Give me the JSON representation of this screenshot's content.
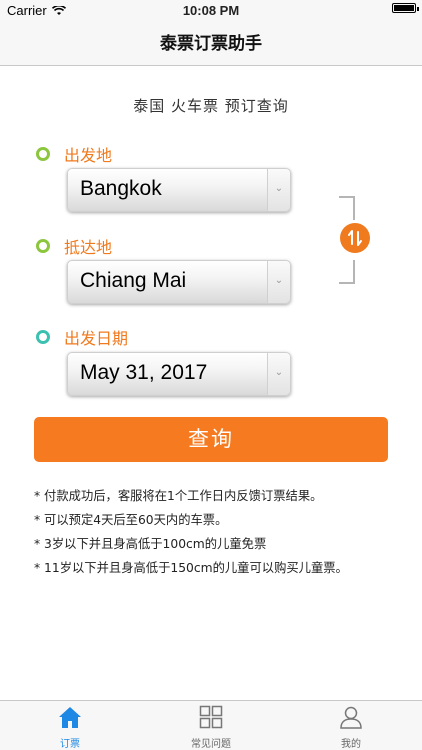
{
  "status_bar": {
    "carrier": "Carrier",
    "time": "10:08 PM",
    "battery_level": 1.0
  },
  "nav": {
    "title": "泰票订票助手"
  },
  "headline": "泰国  火车票  预订查询",
  "from": {
    "label": "出发地",
    "value": "Bangkok"
  },
  "to": {
    "label": "抵达地",
    "value": "Chiang Mai"
  },
  "date": {
    "label": "出发日期",
    "value": "May 31, 2017"
  },
  "query_button": "查询",
  "notes": [
    "* 付款成功后，客服将在1个工作日内反馈订票结果。",
    "* 可以预定4天后至60天内的车票。",
    "* 3岁以下并且身高低于100cm的儿童免票",
    "* 11岁以下并且身高低于150cm的儿童可以购买儿童票。"
  ],
  "tabs": [
    {
      "label": "订票",
      "icon": "home-icon",
      "active": true
    },
    {
      "label": "常见问题",
      "icon": "grid-icon",
      "active": false
    },
    {
      "label": "我的",
      "icon": "person-icon",
      "active": false
    }
  ],
  "colors": {
    "accent": "#f57a20",
    "tab_active": "#1e88e5",
    "dot_green": "#8cc63f",
    "dot_teal": "#3cc1b0"
  }
}
